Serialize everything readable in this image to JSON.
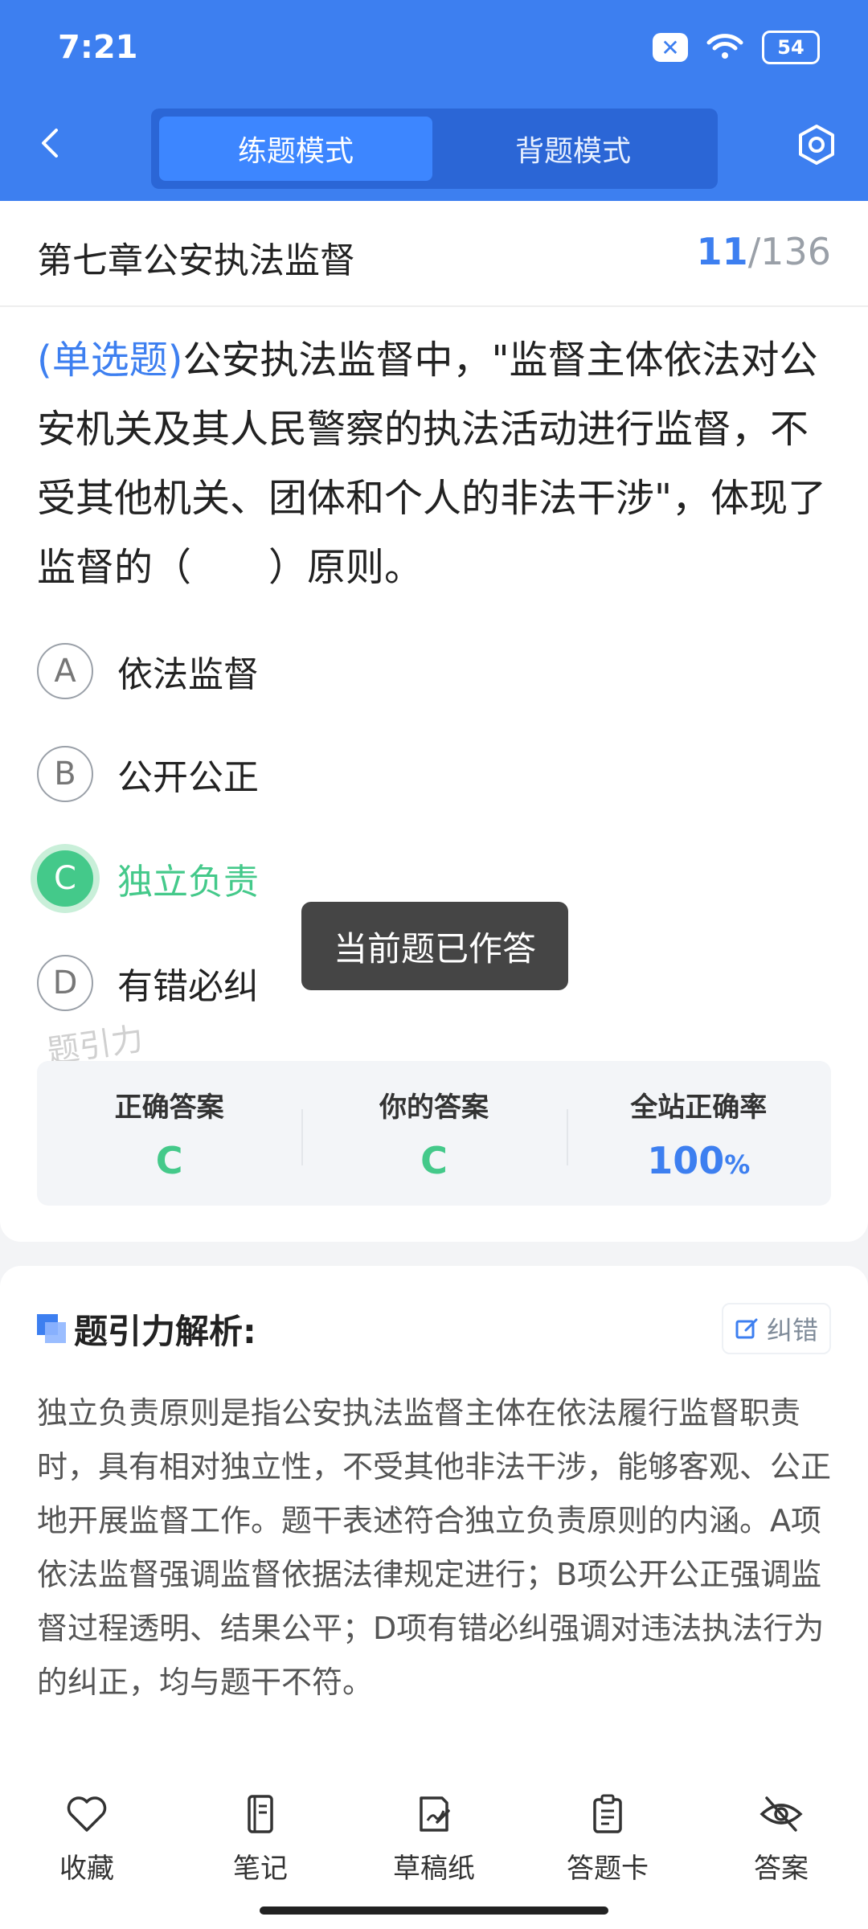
{
  "status_bar": {
    "time": "7:21",
    "battery": "54"
  },
  "header": {
    "tabs": [
      {
        "label": "练题模式",
        "active": true
      },
      {
        "label": "背题模式",
        "active": false
      }
    ]
  },
  "chapter": {
    "title": "第七章公安执法监督",
    "current": "11",
    "total": "/136"
  },
  "question": {
    "type": "(单选题)",
    "text": "公安执法监督中，\"监督主体依法对公安机关及其人民警察的执法活动进行监督，不受其他机关、团体和个人的非法干涉\"，体现了监督的（　　）原则。"
  },
  "options": [
    {
      "letter": "A",
      "text": "依法监督"
    },
    {
      "letter": "B",
      "text": "公开公正"
    },
    {
      "letter": "C",
      "text": "独立负责"
    },
    {
      "letter": "D",
      "text": "有错必纠"
    }
  ],
  "watermark": "题引力",
  "toast": "当前题已作答",
  "stats": {
    "correct_label": "正确答案",
    "correct_value": "C",
    "yours_label": "你的答案",
    "yours_value": "C",
    "rate_label": "全站正确率",
    "rate_value": "100",
    "rate_unit": "%"
  },
  "analysis": {
    "title": "题引力解析:",
    "correct_button": "纠错",
    "text": "独立负责原则是指公安执法监督主体在依法履行监督职责时，具有相对独立性，不受其他非法干涉，能够客观、公正地开展监督工作。题干表述符合独立负责原则的内涵。A项依法监督强调监督依据法律规定进行；B项公开公正强调监督过程透明、结果公平；D项有错必纠强调对违法执法行为的纠正，均与题干不符。"
  },
  "bottom_bar": [
    {
      "label": "收藏",
      "icon": "heart-icon"
    },
    {
      "label": "笔记",
      "icon": "notebook-icon"
    },
    {
      "label": "草稿纸",
      "icon": "draft-icon"
    },
    {
      "label": "答题卡",
      "icon": "clipboard-icon"
    },
    {
      "label": "答案",
      "icon": "eye-off-icon"
    }
  ],
  "colors": {
    "accent": "#3d7ff0",
    "correct": "#44c98a"
  }
}
